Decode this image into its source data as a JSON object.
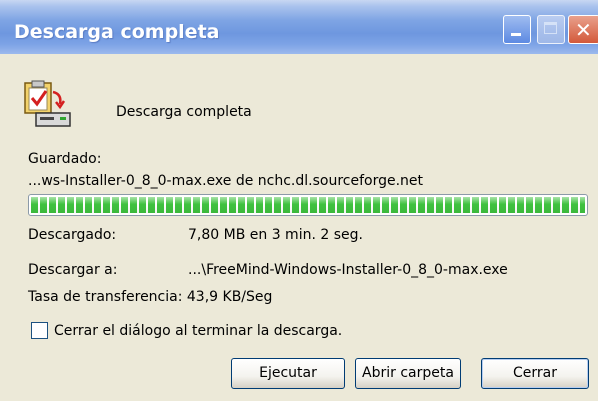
{
  "window": {
    "title": "Descarga completa"
  },
  "header": {
    "icon": "download-complete-icon",
    "message": "Descarga completa"
  },
  "saved": {
    "label": "Guardado:",
    "file": "...ws-Installer-0_8_0-max.exe de nchc.dl.sourceforge.net"
  },
  "progress": {
    "fraction": 1.0,
    "color": "#3fc23f"
  },
  "details": {
    "downloaded_label": "Descargado:",
    "downloaded_value": "7,80 MB en 3 min. 2 seg.",
    "download_to_label": "Descargar a:",
    "download_to_value": "...\\FreeMind-Windows-Installer-0_8_0-max.exe",
    "rate": "Tasa de transferencia: 43,9 KB/Seg"
  },
  "options": {
    "close_on_finish_label": "Cerrar el diálogo al terminar la descarga.",
    "close_on_finish_checked": false
  },
  "buttons": {
    "run": "Ejecutar",
    "open_folder": "Abrir carpeta",
    "close": "Cerrar"
  },
  "colors": {
    "titlebar": "#7ea4e4",
    "face": "#ece9d8",
    "close_button": "#d3593a"
  }
}
